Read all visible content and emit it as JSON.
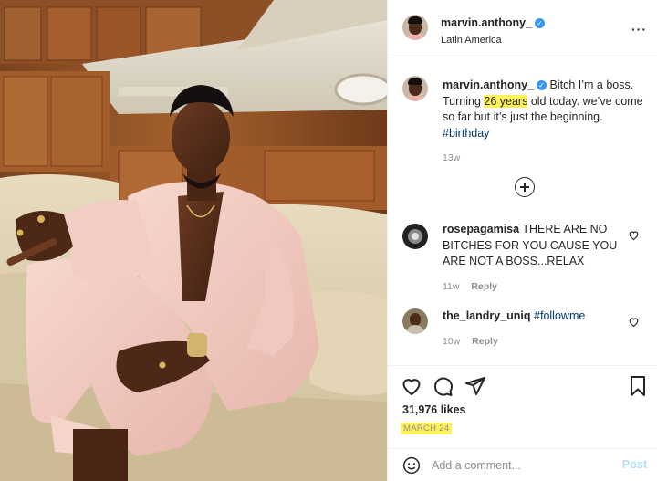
{
  "post": {
    "author": {
      "username": "marvin.anthony_",
      "location": "Latin America",
      "verified": true
    },
    "caption": {
      "username": "marvin.anthony_",
      "text_before": "Bitch I’m a boss. Turning ",
      "highlight": "26 years",
      "text_after": " old today. we’ve come so far but it’s just the beginning. ",
      "hashtag": "#birthday",
      "time": "13w"
    },
    "comments": [
      {
        "username": "rosepagamisa",
        "text": "THERE ARE NO BITCHES FOR YOU CAUSE YOU ARE NOT A BOSS...RELAX",
        "time": "11w",
        "reply_label": "Reply"
      },
      {
        "username": "the_landry_uniq",
        "text": "#followme",
        "time": "10w",
        "reply_label": "Reply"
      }
    ],
    "likes": "31,976 likes",
    "date": "MARCH 24"
  },
  "composer": {
    "placeholder": "Add a comment...",
    "post_label": "Post"
  },
  "icons": {
    "more": "more-options-icon",
    "verified": "verified-badge-icon",
    "load_more": "plus-circle-icon",
    "like": "heart-icon",
    "comment": "comment-bubble-icon",
    "share": "paper-plane-icon",
    "save": "bookmark-icon",
    "emoji": "smiley-icon"
  },
  "colors": {
    "highlight": "#fff15a",
    "verified": "#3897f0",
    "hashtag": "#00376b",
    "post_disabled": "#b2dffc"
  }
}
